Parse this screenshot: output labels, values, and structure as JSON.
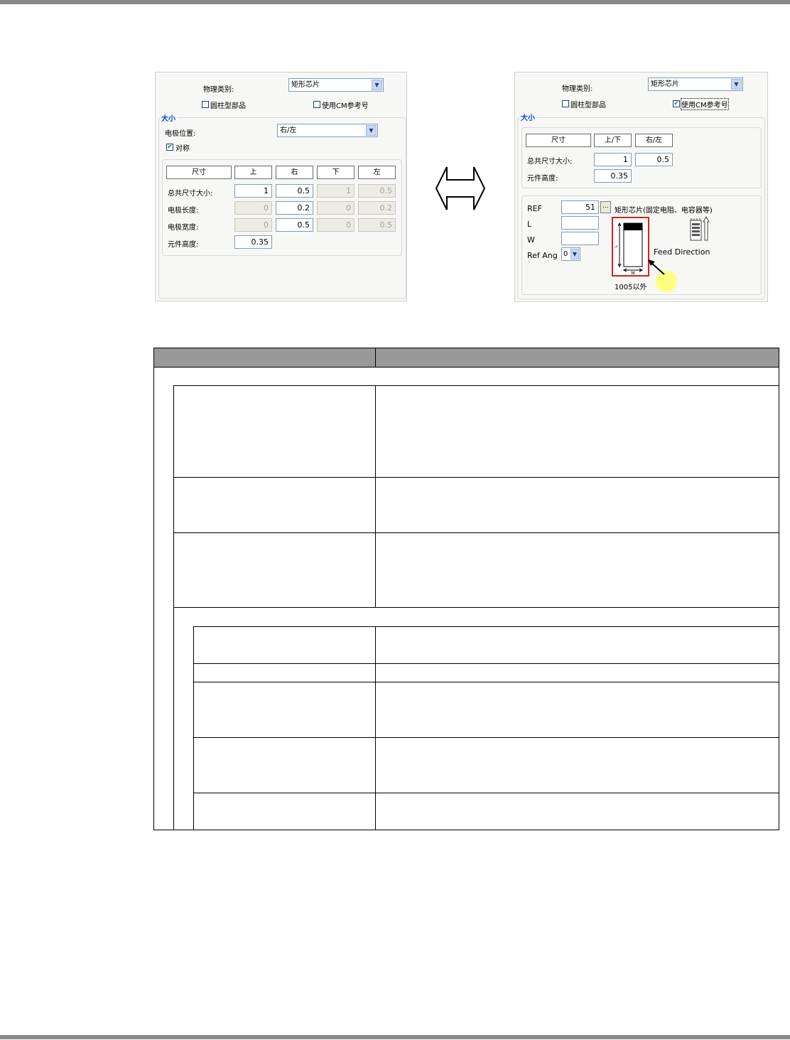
{
  "left_panel": {
    "physical_type_label": "物理类别:",
    "physical_type_value": "矩形芯片",
    "cylinder_label": "圆柱型部品",
    "cylinder_checked": false,
    "use_cm_label": "使用CM参考号",
    "use_cm_checked": false,
    "size_group_label": "大小",
    "electrode_position_label": "电极位置:",
    "electrode_position_value": "右/左",
    "symmetric_label": "对称",
    "symmetric_checked": true,
    "columns": [
      "尺寸",
      "上",
      "右",
      "下",
      "左"
    ],
    "rows": [
      {
        "label": "总共尺寸大小:",
        "values": [
          "1",
          "0.5",
          "1",
          "0.5"
        ],
        "enabled": [
          true,
          true,
          false,
          false
        ]
      },
      {
        "label": "电极长度:",
        "values": [
          "0",
          "0.2",
          "0",
          "0.2"
        ],
        "enabled": [
          false,
          true,
          false,
          false
        ]
      },
      {
        "label": "电极宽度:",
        "values": [
          "0",
          "0.5",
          "0",
          "0.5"
        ],
        "enabled": [
          false,
          true,
          false,
          false
        ]
      }
    ],
    "height_label": "元件高度:",
    "height_value": "0.35"
  },
  "right_panel": {
    "physical_type_label": "物理类别:",
    "physical_type_value": "矩形芯片",
    "cylinder_label": "圆柱型部品",
    "cylinder_checked": false,
    "use_cm_label": "使用CM参考号",
    "use_cm_checked": true,
    "size_group_label": "大小",
    "columns": [
      "尺寸",
      "上/下",
      "右/左"
    ],
    "total_size_label": "总共尺寸大小:",
    "total_size_values": [
      "1",
      "0.5"
    ],
    "height_label": "元件高度:",
    "height_value": "0.35",
    "ref_label": "REF",
    "ref_value": "51",
    "ellipsis_label": "...",
    "ref_description": "矩形芯片(固定电阻、电容器等)",
    "l_label": "L",
    "l_value": "",
    "w_label": "W",
    "w_value": "",
    "ref_ang_label": "Ref Ang",
    "ref_ang_value": "0",
    "feed_direction_label": "Feed Direction",
    "diagram_caption": "1005以外",
    "diagram_l": "L",
    "diagram_w": "W"
  },
  "colors": {
    "highlight_box": "#d62020",
    "callout_circle": "#ffff80",
    "table_header": "#999999",
    "group_label": "#0046d5"
  }
}
